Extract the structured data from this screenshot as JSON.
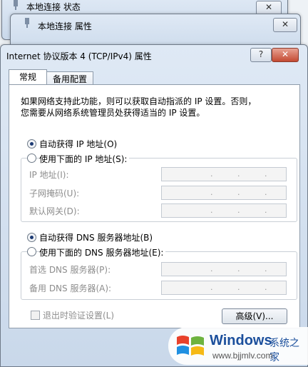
{
  "back_window_1": {
    "title": "本地连接 状态",
    "close": "✕"
  },
  "back_window_2": {
    "title": "本地连接 属性",
    "close": "✕"
  },
  "dialog": {
    "title": "Internet 协议版本 4 (TCP/IPv4) 属性",
    "help": "?",
    "close": "✕",
    "tabs": [
      {
        "label": "常规"
      },
      {
        "label": "备用配置"
      }
    ],
    "description_line1": "如果网络支持此功能，则可以获取自动指派的 IP 设置。否则，",
    "description_line2": "您需要从网络系统管理员处获得适当的 IP 设置。",
    "ip_auto_label": "自动获得 IP 地址(O)",
    "ip_manual_label": "使用下面的 IP 地址(S):",
    "ip_fields": [
      {
        "label": "IP 地址(I):"
      },
      {
        "label": "子网掩码(U):"
      },
      {
        "label": "默认网关(D):"
      }
    ],
    "dns_auto_label": "自动获得 DNS 服务器地址(B)",
    "dns_manual_label": "使用下面的 DNS 服务器地址(E):",
    "dns_fields": [
      {
        "label": "首选 DNS 服务器(P):"
      },
      {
        "label": "备用 DNS 服务器(A):"
      }
    ],
    "ip_dot": ".",
    "validate_label": "退出时验证设置(L)",
    "advanced_button": "高级(V)..."
  },
  "watermark": {
    "brand": "Windows",
    "cn": "系统之家",
    "url": "www.bjjmlv.com"
  }
}
